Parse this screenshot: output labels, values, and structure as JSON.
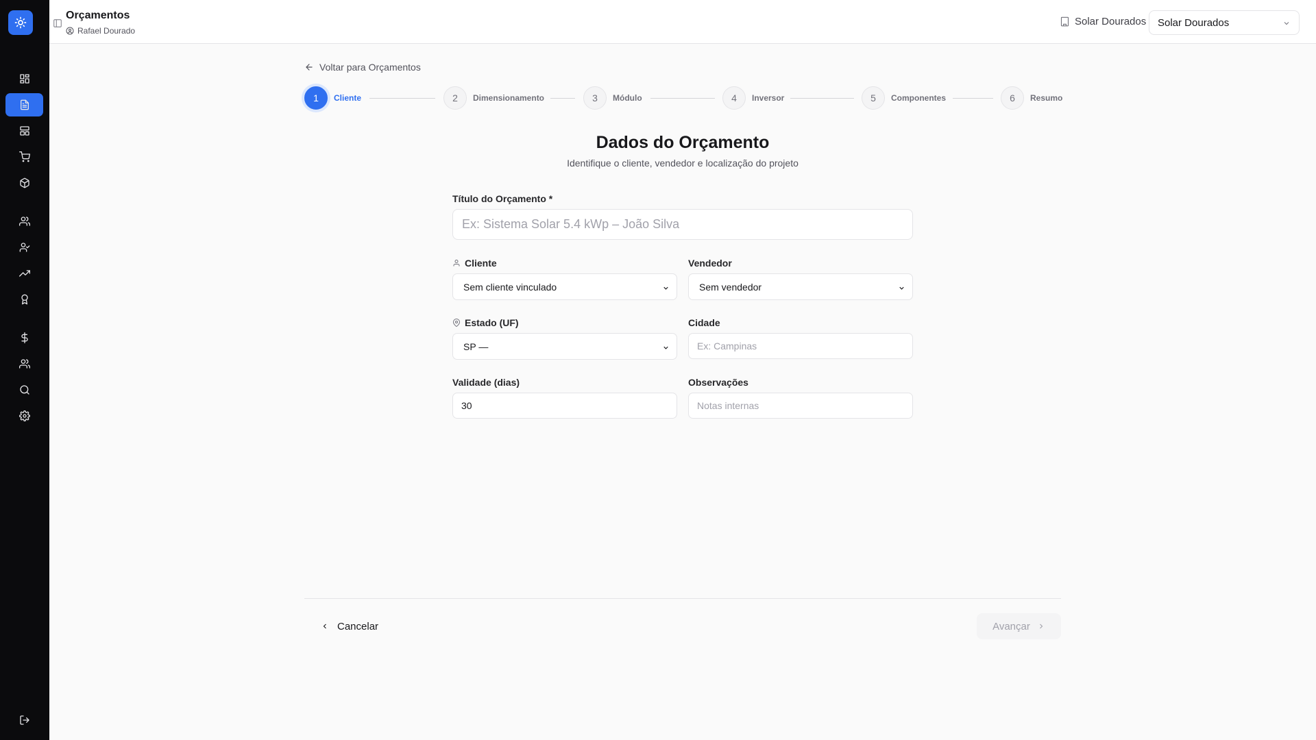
{
  "colors": {
    "accent": "#2f6ff0",
    "sidebar": "#0b0b0d",
    "page_bg": "#fafafa"
  },
  "sidebar": {
    "logo_icon": "sun-icon",
    "items": [
      {
        "icon": "dashboard-icon",
        "active": false
      },
      {
        "icon": "file-text-icon",
        "active": true
      },
      {
        "icon": "layout-icon",
        "active": false
      },
      {
        "icon": "cart-icon",
        "active": false
      },
      {
        "icon": "package-icon",
        "active": false
      },
      {
        "icon": "users-icon",
        "active": false
      },
      {
        "icon": "user-check-icon",
        "active": false
      },
      {
        "icon": "trending-up-icon",
        "active": false
      },
      {
        "icon": "award-icon",
        "active": false
      },
      {
        "icon": "dollar-icon",
        "active": false
      },
      {
        "icon": "team-icon",
        "active": false
      },
      {
        "icon": "search-icon",
        "active": false
      },
      {
        "icon": "settings-icon",
        "active": false
      }
    ],
    "logout_icon": "logout-icon"
  },
  "header": {
    "title": "Orçamentos",
    "user": "Rafael Dourado",
    "company_label": "Solar Dourados",
    "company_select": "Solar Dourados"
  },
  "back_link": "Voltar para Orçamentos",
  "steps": [
    {
      "number": "1",
      "label": "Cliente",
      "active": true
    },
    {
      "number": "2",
      "label": "Dimensionamento",
      "active": false
    },
    {
      "number": "3",
      "label": "Módulo",
      "active": false
    },
    {
      "number": "4",
      "label": "Inversor",
      "active": false
    },
    {
      "number": "5",
      "label": "Componentes",
      "active": false
    },
    {
      "number": "6",
      "label": "Resumo",
      "active": false
    }
  ],
  "form": {
    "heading": "Dados do Orçamento",
    "subheading": "Identifique o cliente, vendedor e localização do projeto",
    "title_label": "Título do Orçamento *",
    "title_placeholder": "Ex: Sistema Solar 5.4 kWp – João Silva",
    "client_label": "Cliente",
    "client_value": "Sem cliente vinculado",
    "seller_label": "Vendedor",
    "seller_value": "Sem vendedor",
    "state_label": "Estado (UF)",
    "state_value": "SP —",
    "city_label": "Cidade",
    "city_placeholder": "Ex: Campinas",
    "validity_label": "Validade (dias)",
    "validity_value": "30",
    "notes_label": "Observações",
    "notes_placeholder": "Notas internas"
  },
  "footer": {
    "cancel": "Cancelar",
    "next": "Avançar"
  }
}
